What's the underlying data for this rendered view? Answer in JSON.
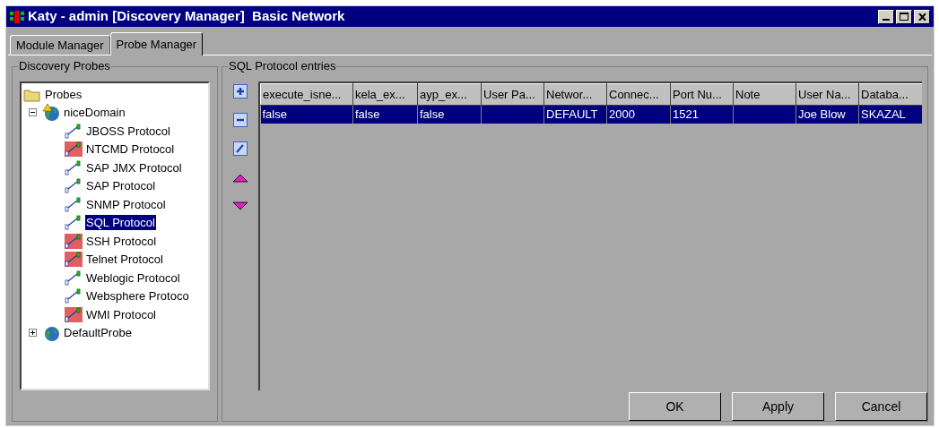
{
  "window": {
    "title": "Katy - admin [Discovery Manager]  Basic Network"
  },
  "tabs": [
    {
      "label": "Module Manager",
      "selected": false
    },
    {
      "label": "Probe Manager",
      "selected": true
    }
  ],
  "probes_panel": {
    "title": "Discovery Probes",
    "tree": {
      "label": "Probes",
      "children": [
        {
          "label": "niceDomain",
          "expanded": true,
          "warning": true,
          "selected": false,
          "children": [
            {
              "label": "JBOSS Protocol",
              "failed": false,
              "selected": false
            },
            {
              "label": "NTCMD Protocol",
              "failed": true,
              "selected": false
            },
            {
              "label": "SAP JMX Protocol",
              "failed": false,
              "selected": false
            },
            {
              "label": "SAP Protocol",
              "failed": false,
              "selected": false
            },
            {
              "label": "SNMP Protocol",
              "failed": false,
              "selected": false
            },
            {
              "label": "SQL Protocol",
              "failed": false,
              "selected": true
            },
            {
              "label": "SSH Protocol",
              "failed": true,
              "selected": false
            },
            {
              "label": "Telnet Protocol",
              "failed": true,
              "selected": false
            },
            {
              "label": "Weblogic Protocol",
              "failed": false,
              "selected": false
            },
            {
              "label": "Websphere Protoco",
              "failed": false,
              "selected": false
            },
            {
              "label": "WMI Protocol",
              "failed": true,
              "selected": false
            }
          ]
        },
        {
          "label": "DefaultProbe",
          "expanded": false,
          "warning": false,
          "selected": false
        }
      ]
    }
  },
  "entries_panel": {
    "title": "SQL Protocol entries",
    "tools": [
      {
        "kind": "add"
      },
      {
        "kind": "remove"
      },
      {
        "kind": "edit"
      },
      {
        "kind": "up"
      },
      {
        "kind": "down"
      }
    ],
    "table": {
      "columns": [
        {
          "label": "execute_isne..."
        },
        {
          "label": "kela_ex..."
        },
        {
          "label": "ayp_ex..."
        },
        {
          "label": "User Pa..."
        },
        {
          "label": "Networ..."
        },
        {
          "label": "Connec..."
        },
        {
          "label": "Port Nu..."
        },
        {
          "label": "Note"
        },
        {
          "label": "User Na..."
        },
        {
          "label": "Databa..."
        }
      ],
      "rows": [
        {
          "selected": true,
          "cells": [
            "false",
            "false",
            "false",
            "",
            "DEFAULT",
            "2000",
            "1521",
            "",
            "Joe Blow",
            "SKAZAL"
          ]
        }
      ]
    }
  },
  "buttons": [
    "OK",
    "Apply",
    "Cancel"
  ]
}
